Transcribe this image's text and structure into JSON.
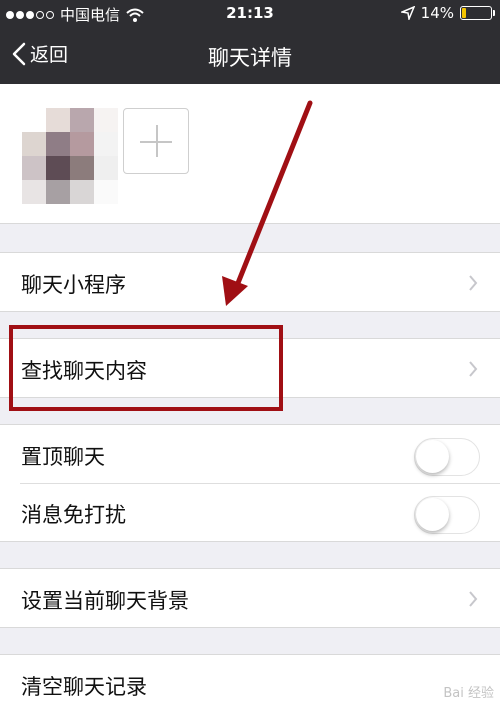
{
  "status_bar": {
    "carrier": "中国电信",
    "time": "21:13",
    "battery_percent": "14%",
    "battery_level": 0.14,
    "battery_color": "#f4c400",
    "signal_icon": "signal-dots-icon",
    "wifi_icon": "wifi-icon",
    "location_icon": "location-arrow-icon"
  },
  "nav": {
    "back_label": "返回",
    "title": "聊天详情"
  },
  "members": {
    "add_icon": "plus-icon"
  },
  "settings": {
    "mini_programs": "聊天小程序",
    "search_chat": "查找聊天内容",
    "sticky_on_top": "置顶聊天",
    "mute_notifications": "消息免打扰",
    "sticky_on_top_enabled": false,
    "mute_notifications_enabled": false,
    "set_background": "设置当前聊天背景",
    "clear_history": "清空聊天记录"
  },
  "watermark": "Bai 经验",
  "colors": {
    "nav_bg": "#2e2e32",
    "page_bg": "#efeff4",
    "annotation_red": "#a00f14"
  }
}
